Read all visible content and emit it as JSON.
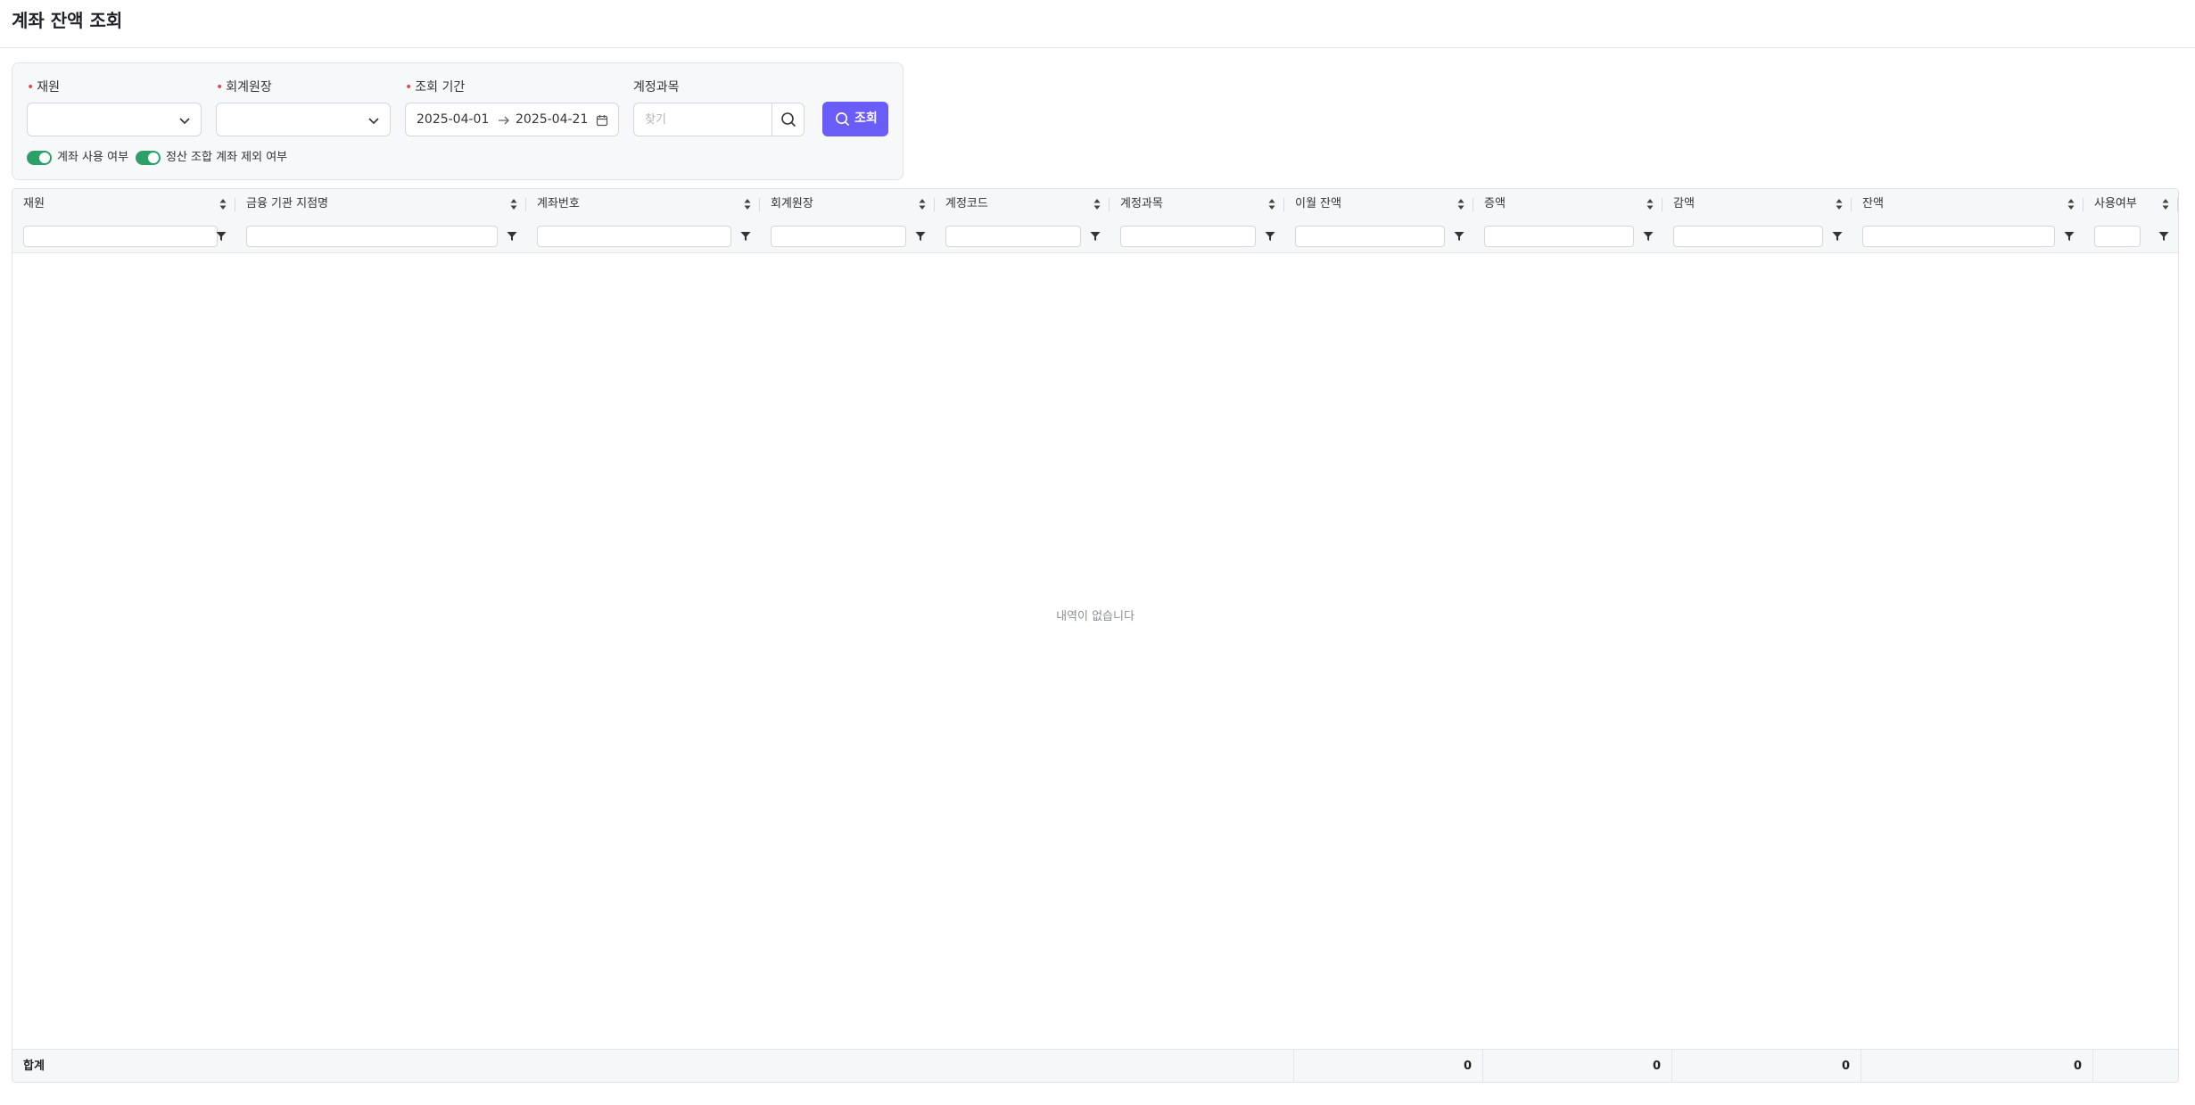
{
  "page": {
    "title": "계좌 잔액 조회"
  },
  "filters": {
    "fund": {
      "label": "재원",
      "required": true,
      "value": ""
    },
    "ledger": {
      "label": "회계원장",
      "required": true,
      "value": ""
    },
    "period": {
      "label": "조회 기간",
      "required": true,
      "start": "2025-04-01",
      "end": "2025-04-21"
    },
    "account_subject": {
      "label": "계정과목",
      "placeholder": "찾기",
      "value": ""
    },
    "query_button": "조회",
    "toggles": [
      {
        "label": "계좌 사용 여부",
        "on": true
      },
      {
        "label": "정산 조합 계좌 제외 여부",
        "on": true
      }
    ]
  },
  "grid": {
    "columns": [
      {
        "label": "재원"
      },
      {
        "label": "금융 기관 지점명"
      },
      {
        "label": "계좌번호"
      },
      {
        "label": "회계원장"
      },
      {
        "label": "계정코드"
      },
      {
        "label": "계정과목"
      },
      {
        "label": "이월 잔액"
      },
      {
        "label": "증액"
      },
      {
        "label": "감액"
      },
      {
        "label": "잔액"
      },
      {
        "label": "사용여부"
      }
    ],
    "empty_message": "내역이 없습니다",
    "totals": {
      "label": "합계",
      "carryover": "0",
      "increase": "0",
      "decrease": "0",
      "balance": "0"
    }
  },
  "colors": {
    "accent": "#6a5cf6",
    "toggle_on": "#2ba067",
    "required": "#e5484d"
  }
}
